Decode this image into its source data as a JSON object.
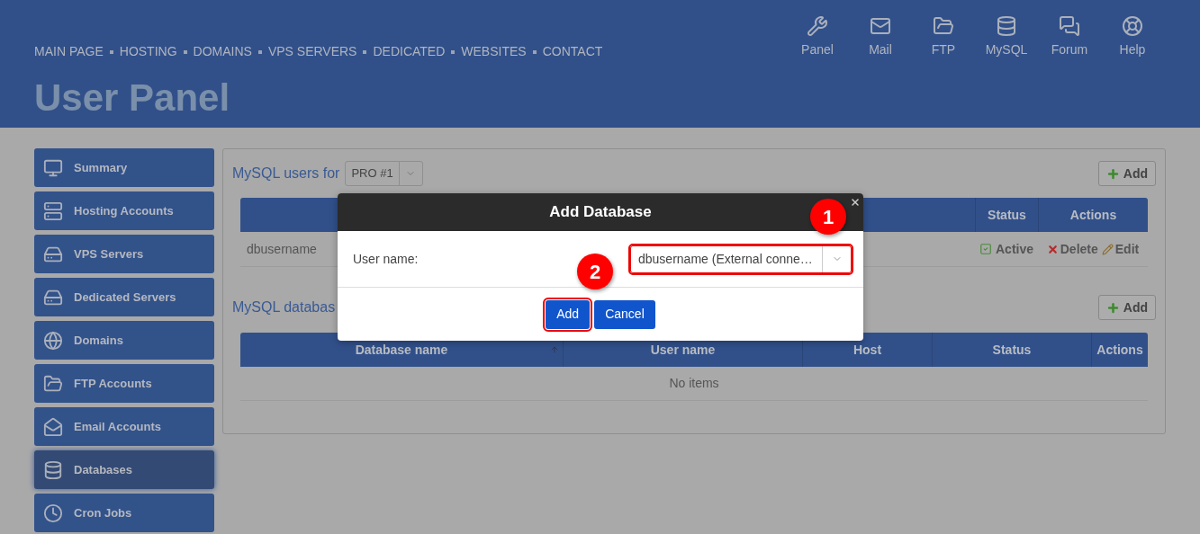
{
  "nav": [
    "MAIN PAGE",
    "HOSTING",
    "DOMAINS",
    "VPS SERVERS",
    "DEDICATED",
    "WEBSITES",
    "CONTACT"
  ],
  "shortcuts": [
    "Panel",
    "Mail",
    "FTP",
    "MySQL",
    "Forum",
    "Help"
  ],
  "page_title": "User Panel",
  "sidebar": {
    "items": [
      {
        "label": "Summary",
        "selected": false
      },
      {
        "label": "Hosting Accounts",
        "selected": false
      },
      {
        "label": "VPS Servers",
        "selected": false
      },
      {
        "label": "Dedicated Servers",
        "selected": false
      },
      {
        "label": "Domains",
        "selected": false
      },
      {
        "label": "FTP Accounts",
        "selected": false
      },
      {
        "label": "Email Accounts",
        "selected": false
      },
      {
        "label": "Databases",
        "selected": true
      },
      {
        "label": "Cron Jobs",
        "selected": false
      }
    ]
  },
  "users_section": {
    "title": "MySQL users for",
    "plan_select": {
      "value": "PRO #1"
    },
    "add_button": "Add",
    "columns": [
      "Status",
      "Actions"
    ],
    "rows": [
      {
        "name": "dbusername",
        "status": "Active",
        "actions": [
          "Delete",
          "Edit"
        ]
      }
    ]
  },
  "databases_section": {
    "title": "MySQL databas",
    "add_button": "Add",
    "columns": [
      {
        "label": "Database name",
        "sorted": true
      },
      {
        "label": "User name",
        "sorted": false
      },
      {
        "label": "Host",
        "sorted": false
      },
      {
        "label": "Status",
        "sorted": false
      },
      {
        "label": "Actions",
        "sorted": false
      }
    ],
    "empty_text": "No items"
  },
  "dialog": {
    "title": "Add Database",
    "field": {
      "label": "User name:",
      "value": "dbusername (External conne…",
      "highlighted": true
    },
    "buttons": [
      {
        "label": "Add",
        "highlighted": true
      },
      {
        "label": "Cancel",
        "highlighted": false
      }
    ]
  },
  "annotations": [
    "1",
    "2"
  ]
}
